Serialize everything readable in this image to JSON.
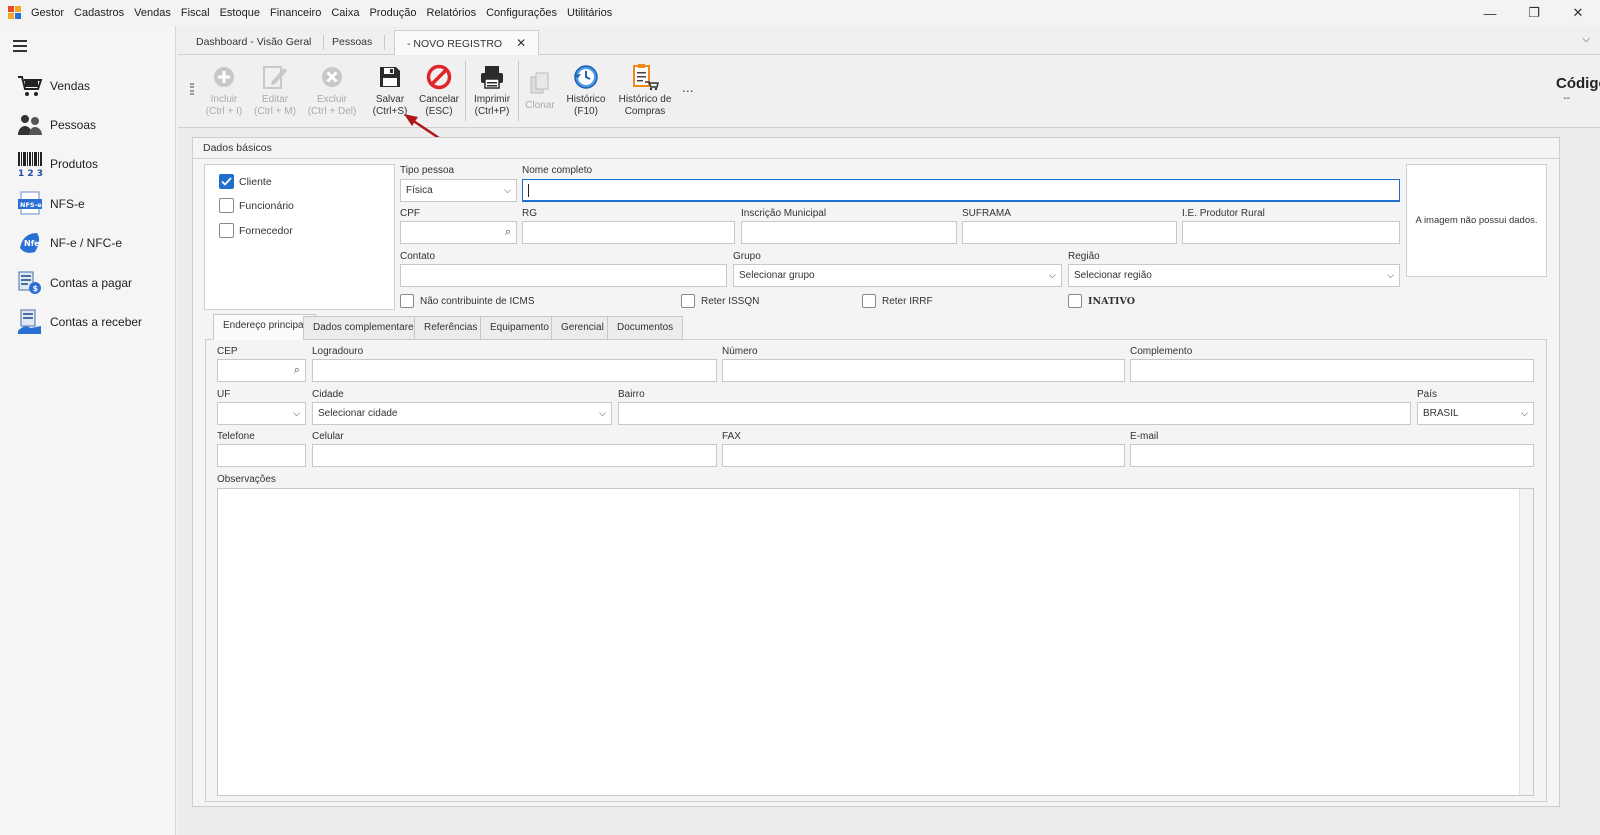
{
  "menubar": {
    "app_name": "Gestor",
    "items": [
      "Cadastros",
      "Vendas",
      "Fiscal",
      "Estoque",
      "Financeiro",
      "Caixa",
      "Produção",
      "Relatórios",
      "Configurações",
      "Utilitários"
    ],
    "minimize": "—",
    "restore": "❐",
    "close": "✕"
  },
  "sidebar": {
    "items": [
      {
        "label": "Vendas",
        "icon": "cart-icon"
      },
      {
        "label": "Pessoas",
        "icon": "people-icon"
      },
      {
        "label": "Produtos",
        "icon": "barcode-icon"
      },
      {
        "label": "NFS-e",
        "icon": "nfse-icon"
      },
      {
        "label": "NF-e / NFC-e",
        "icon": "nfe-icon"
      },
      {
        "label": "Contas a pagar",
        "icon": "payable-icon"
      },
      {
        "label": "Contas a receber",
        "icon": "receivable-icon"
      }
    ]
  },
  "doc_tabs": {
    "tab1": "Dashboard - Visão Geral",
    "tab2": "Pessoas",
    "tab3": "- NOVO REGISTRO",
    "close": "✕",
    "dropdown": "⌵"
  },
  "toolbar": {
    "incluir": {
      "label": "Incluir",
      "shortcut": "(Ctrl + I)"
    },
    "editar": {
      "label": "Editar",
      "shortcut": "(Ctrl + M)"
    },
    "excluir": {
      "label": "Excluir",
      "shortcut": "(Ctrl + Del)"
    },
    "salvar": {
      "label": "Salvar",
      "shortcut": "(Ctrl+S)"
    },
    "cancelar": {
      "label": "Cancelar",
      "shortcut": "(ESC)"
    },
    "imprimir": {
      "label": "Imprimir",
      "shortcut": "(Ctrl+P)"
    },
    "clonar": {
      "label": "Clonar"
    },
    "historico": {
      "label": "Histórico",
      "shortcut": "(F10)"
    },
    "historico_compras": {
      "label": "Histórico de",
      "label2": "Compras"
    },
    "more": "...",
    "codigo_label": "Código",
    "codigo_value": "--"
  },
  "form": {
    "group_title": "Dados básicos",
    "checks": {
      "cliente": {
        "label": "Cliente",
        "checked": true
      },
      "funcionario": {
        "label": "Funcionário",
        "checked": false
      },
      "fornecedor": {
        "label": "Fornecedor",
        "checked": false
      }
    },
    "tipo_pessoa": {
      "label": "Tipo pessoa",
      "value": "Física"
    },
    "nome_completo": {
      "label": "Nome completo",
      "value": ""
    },
    "cpf": {
      "label": "CPF"
    },
    "rg": {
      "label": "RG"
    },
    "inscricao_municipal": {
      "label": "Inscrição Municipal"
    },
    "suframa": {
      "label": "SUFRAMA"
    },
    "ie_produtor": {
      "label": "I.E. Produtor Rural"
    },
    "contato": {
      "label": "Contato"
    },
    "grupo": {
      "label": "Grupo",
      "value": "Selecionar grupo"
    },
    "regiao": {
      "label": "Região",
      "value": "Selecionar região"
    },
    "image_text": "A imagem não possui dados.",
    "nao_contribuinte": "Não contribuinte de ICMS",
    "reter_issqn": "Reter ISSQN",
    "reter_irrf": "Reter IRRF",
    "inativo": "INATIVO"
  },
  "inner_tabs": [
    "Endereço principal",
    "Dados complementares",
    "Referências",
    "Equipamento",
    "Gerencial",
    "Documentos"
  ],
  "address": {
    "cep": "CEP",
    "logradouro": "Logradouro",
    "numero": "Número",
    "complemento": "Complemento",
    "uf": "UF",
    "cidade": {
      "label": "Cidade",
      "value": "Selecionar cidade"
    },
    "bairro": "Bairro",
    "pais": {
      "label": "País",
      "value": "BRASIL"
    },
    "telefone": "Telefone",
    "celular": "Celular",
    "fax": "FAX",
    "email": "E-mail",
    "observacoes": "Observações"
  },
  "colors": {
    "accent": "#1f6fcf",
    "cancel_red": "#e0262b",
    "annotation_arrow": "#b01818"
  }
}
